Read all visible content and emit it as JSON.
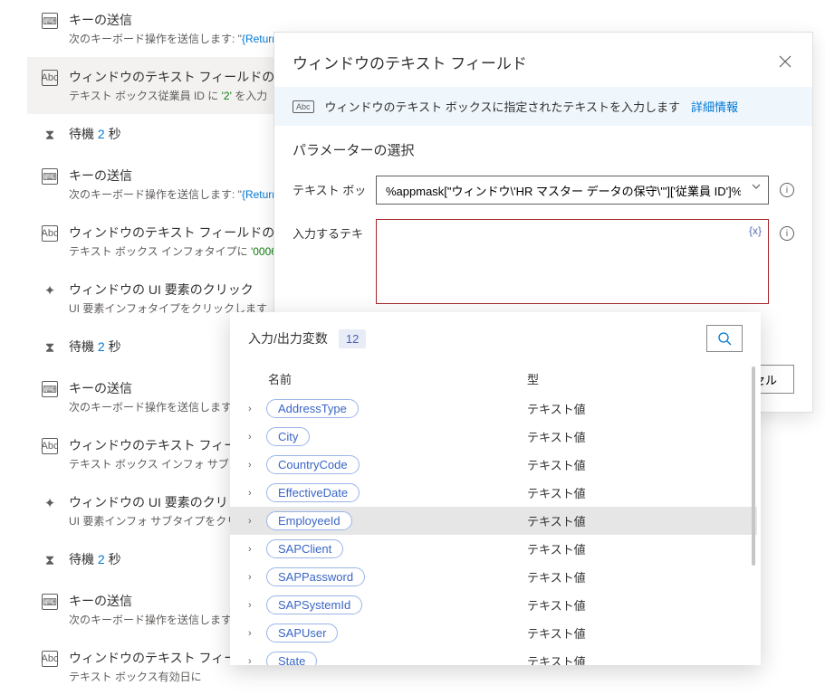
{
  "actions": [
    {
      "icon": "⌨",
      "title": "キーの送信",
      "desc_prefix": "次のキーボード操作を送信します: \"",
      "desc_token": "{Return",
      "token_class": "txt-blue"
    },
    {
      "icon": "Abc",
      "title": "ウィンドウのテキスト フィールドの入",
      "desc_prefix": "テキスト ボックス従業員 ID に ",
      "desc_token": "'2'",
      "desc_suffix": " を入力",
      "token_class": "txt-green",
      "selected": true
    },
    {
      "icon": "⧗",
      "title_prefix": "待機 ",
      "title_num": "2",
      "title_suffix": " 秒",
      "no_border": true
    },
    {
      "icon": "⌨",
      "title": "キーの送信",
      "desc_prefix": "次のキーボード操作を送信します: \"",
      "desc_token": "{Return",
      "token_class": "txt-blue"
    },
    {
      "icon": "Abc",
      "title": "ウィンドウのテキスト フィールドの入",
      "desc_prefix": "テキスト ボックス インフォタイプに ",
      "desc_token": "'0006",
      "token_class": "txt-green"
    },
    {
      "icon": "✦",
      "title": "ウィンドウの UI 要素のクリック",
      "desc_prefix": "UI 要素インフォタイプをクリックします",
      "no_border": true
    },
    {
      "icon": "⧗",
      "title_prefix": "待機 ",
      "title_num": "2",
      "title_suffix": " 秒",
      "no_border": true
    },
    {
      "icon": "⌨",
      "title": "キーの送信",
      "desc_prefix": "次のキーボード操作を送信します: "
    },
    {
      "icon": "Abc",
      "title": "ウィンドウのテキスト フィール",
      "desc_prefix": "テキスト ボックス インフォ サブタ"
    },
    {
      "icon": "✦",
      "title": "ウィンドウの UI 要素のクリッ",
      "desc_prefix": "UI 要素インフォ サブタイプをクリ",
      "no_border": true
    },
    {
      "icon": "⧗",
      "title_prefix": "待機 ",
      "title_num": "2",
      "title_suffix": " 秒",
      "no_border": true
    },
    {
      "icon": "⌨",
      "title": "キーの送信",
      "desc_prefix": "次のキーボード操作を送信します: "
    },
    {
      "icon": "Abc",
      "title": "ウィンドウのテキスト フィー",
      "desc_prefix": "テキスト ボックス有効日に"
    }
  ],
  "dialog": {
    "title": "ウィンドウのテキスト フィールド",
    "info_icon": "Abc",
    "info_text": "ウィンドウのテキスト ボックスに指定されたテキストを入力します",
    "info_link": "詳細情報",
    "section_title": "パラメーターの選択",
    "form": {
      "textbox_label": "テキスト ボッ",
      "textbox_value": "%appmask[\"ウィンドウ\\'HR マスター データの保守\\'\"]['従業員 ID']%",
      "text_label": "入力するテキ",
      "text_value": "",
      "var_token": "{x}"
    },
    "cancel_label": "セル"
  },
  "popover": {
    "heading": "入力/出力変数",
    "count": "12",
    "col_name": "名前",
    "col_type": "型",
    "type_text": "テキスト値",
    "vars": [
      {
        "name": "AddressType"
      },
      {
        "name": "City"
      },
      {
        "name": "CountryCode"
      },
      {
        "name": "EffectiveDate"
      },
      {
        "name": "EmployeeId",
        "selected": true
      },
      {
        "name": "SAPClient"
      },
      {
        "name": "SAPPassword"
      },
      {
        "name": "SAPSystemId"
      },
      {
        "name": "SAPUser"
      },
      {
        "name": "State"
      }
    ]
  }
}
